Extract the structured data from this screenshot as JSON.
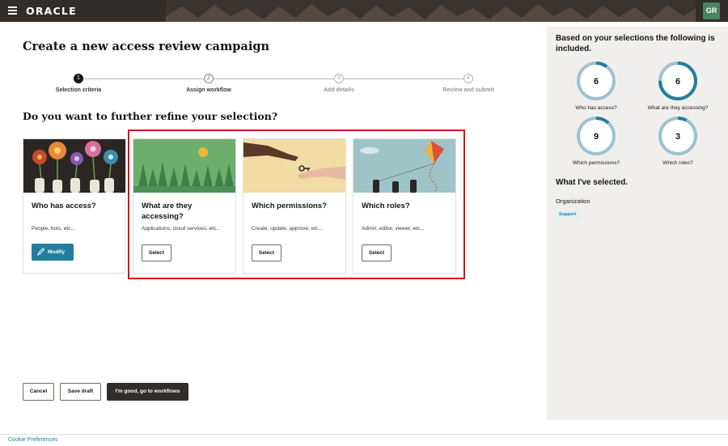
{
  "header": {
    "logo_text": "ORACLE",
    "avatar_initials": "GR",
    "colors": {
      "bar": "#312d2a",
      "avatar": "#4c825c"
    }
  },
  "page": {
    "title": "Create a new access review campaign",
    "refine_question": "Do you want to further refine your selection?"
  },
  "steps": [
    {
      "number": "1",
      "label": "Selection criteria",
      "state": "active"
    },
    {
      "number": "2",
      "label": "Assign workflow",
      "state": "upcoming"
    },
    {
      "number": "3",
      "label": "Add details",
      "state": "disabled"
    },
    {
      "number": "4",
      "label": "Review and submit",
      "state": "disabled"
    }
  ],
  "cards": [
    {
      "title": "Who has access?",
      "description": "People, bots, etc...",
      "button": "Modify",
      "image": "flowers-hands-illustration"
    },
    {
      "title": "What are they accessing?",
      "description": "Applications, cloud services, etc...",
      "button": "Select",
      "image": "forest-sun-illustration"
    },
    {
      "title": "Which permissions?",
      "description": "Create, update, approve, etc...",
      "button": "Select",
      "image": "hands-key-illustration"
    },
    {
      "title": "Which roles?",
      "description": "Admin, editor, viewer, etc...",
      "button": "Select",
      "image": "kite-illustration"
    }
  ],
  "actions": {
    "cancel": "Cancel",
    "save_draft": "Save draft",
    "primary": "I'm good, go to workflows"
  },
  "summary": {
    "heading": "Based on your selections the following is included.",
    "metrics": [
      {
        "value": "6",
        "label": "Who has access?",
        "fill": 0.1
      },
      {
        "value": "6",
        "label": "What are they accessing?",
        "fill": 0.75
      },
      {
        "value": "9",
        "label": "Which permissions?",
        "fill": 0.12
      },
      {
        "value": "3",
        "label": "Which roles?",
        "fill": 0.08
      }
    ],
    "ring_colors": {
      "track": "#9fc1cf",
      "fill": "#227e9e"
    },
    "selected_heading": "What I've selected.",
    "org_label": "Organization",
    "org_badge": "Support"
  },
  "footer": {
    "cookie_link": "Cookie Preferences"
  }
}
